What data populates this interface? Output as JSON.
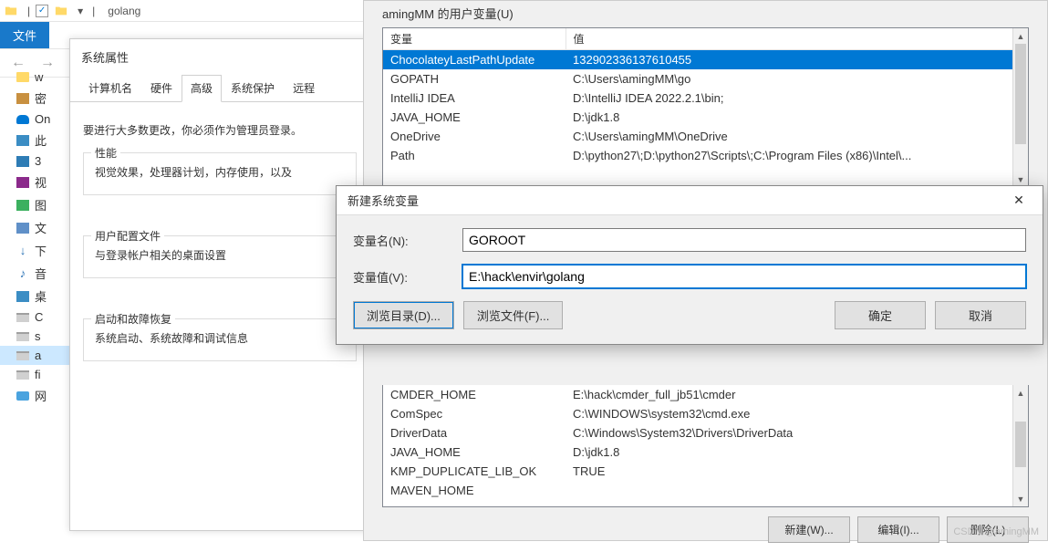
{
  "explorer": {
    "title": "golang",
    "file_tab": "文件",
    "sep": "|",
    "chevron": "▾",
    "back": "←",
    "fwd": "→"
  },
  "sidebar": {
    "items": [
      {
        "label": "w",
        "icon": "sb-folder"
      },
      {
        "label": "密",
        "icon": "sb-sys"
      },
      {
        "label": "On",
        "icon": "sb-od"
      },
      {
        "label": "此",
        "icon": "sb-pc"
      },
      {
        "label": "3",
        "icon": "sb-3d"
      },
      {
        "label": "视",
        "icon": "sb-vid"
      },
      {
        "label": "图",
        "icon": "sb-pic"
      },
      {
        "label": "文",
        "icon": "sb-doc"
      },
      {
        "label": "下",
        "icon": "sb-dl"
      },
      {
        "label": "音",
        "icon": "sb-mu"
      },
      {
        "label": "桌",
        "icon": "sb-dsk"
      },
      {
        "label": "C",
        "icon": "sb-disk"
      },
      {
        "label": "s",
        "icon": "sb-disk"
      },
      {
        "label": "a",
        "icon": "sb-disk"
      },
      {
        "label": "fi",
        "icon": "sb-disk"
      },
      {
        "label": "网",
        "icon": "sb-net"
      }
    ]
  },
  "sysprops": {
    "title": "系统属性",
    "tabs": [
      "计算机名",
      "硬件",
      "高级",
      "系统保护",
      "远程"
    ],
    "active_tab": 2,
    "notice": "要进行大多数更改，你必须作为管理员登录。",
    "perf": {
      "label": "性能",
      "text": "视觉效果，处理器计划，内存使用，以及"
    },
    "profile": {
      "label": "用户配置文件",
      "text": "与登录帐户相关的桌面设置"
    },
    "startup": {
      "label": "启动和故障恢复",
      "text": "系统启动、系统故障和调试信息"
    }
  },
  "env": {
    "user_section": "amingMM 的用户变量(U)",
    "col_var": "变量",
    "col_val": "值",
    "user_vars": [
      {
        "k": "ChocolateyLastPathUpdate",
        "v": "132902336137610455",
        "sel": true
      },
      {
        "k": "GOPATH",
        "v": "C:\\Users\\amingMM\\go"
      },
      {
        "k": "IntelliJ IDEA",
        "v": "D:\\IntelliJ IDEA 2022.2.1\\bin;"
      },
      {
        "k": "JAVA_HOME",
        "v": "D:\\jdk1.8"
      },
      {
        "k": "OneDrive",
        "v": "C:\\Users\\amingMM\\OneDrive"
      },
      {
        "k": "Path",
        "v": "D:\\python27\\;D:\\python27\\Scripts\\;C:\\Program Files (x86)\\Intel\\..."
      }
    ],
    "sys_vars": [
      {
        "k": "CMDER_HOME",
        "v": "E:\\hack\\cmder_full_jb51\\cmder"
      },
      {
        "k": "ComSpec",
        "v": "C:\\WINDOWS\\system32\\cmd.exe"
      },
      {
        "k": "DriverData",
        "v": "C:\\Windows\\System32\\Drivers\\DriverData"
      },
      {
        "k": "JAVA_HOME",
        "v": "D:\\jdk1.8"
      },
      {
        "k": "KMP_DUPLICATE_LIB_OK",
        "v": "TRUE"
      },
      {
        "k": "MAVEN_HOME",
        "v": ""
      }
    ],
    "btn_new": "新建(W)...",
    "btn_edit": "编辑(I)...",
    "btn_del": "删除(L)"
  },
  "newvar": {
    "title": "新建系统变量",
    "name_label": "变量名(N):",
    "value_label": "变量值(V):",
    "name_value": "GOROOT",
    "value_value": "E:\\hack\\envir\\golang",
    "browse_dir": "浏览目录(D)...",
    "browse_file": "浏览文件(F)...",
    "ok": "确定",
    "cancel": "取消"
  },
  "watermark": "CSDN @amingMM"
}
